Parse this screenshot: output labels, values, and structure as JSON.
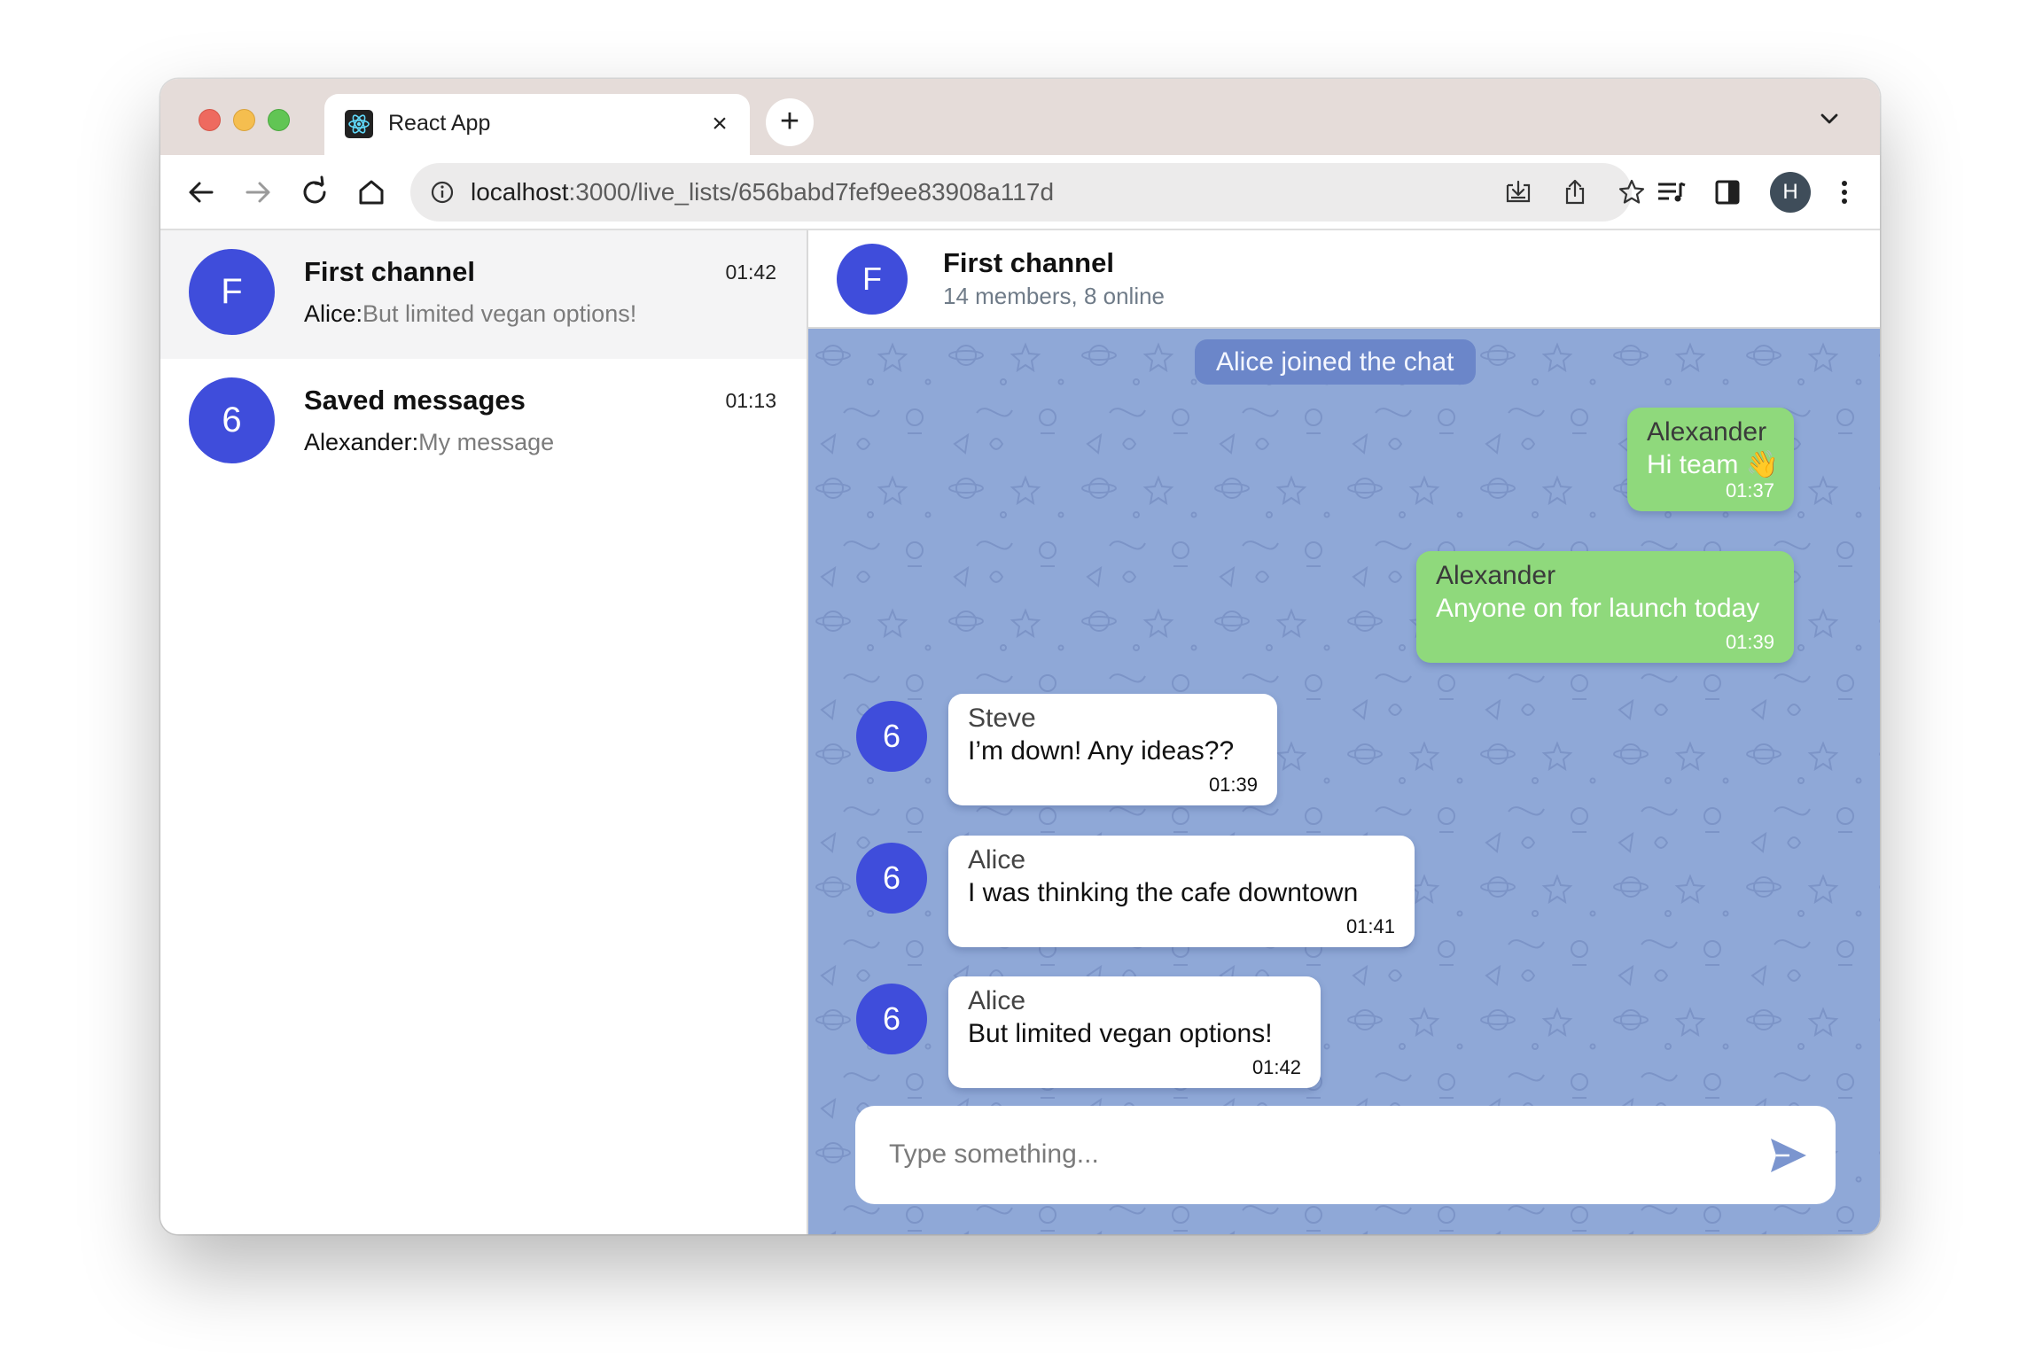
{
  "browser": {
    "tab_title": "React App",
    "tab_close": "×",
    "new_tab": "+",
    "url_host": "localhost",
    "url_path": ":3000/live_lists/656babd7fef9ee83908a117d",
    "profile_initial": "H"
  },
  "sidebar": {
    "chats": [
      {
        "avatar": "F",
        "name": "First channel",
        "time": "01:42",
        "sender": "Alice:",
        "preview": "But limited vegan options!"
      },
      {
        "avatar": "6",
        "name": "Saved messages",
        "time": "01:13",
        "sender": "Alexander:",
        "preview": "My message"
      }
    ]
  },
  "header": {
    "avatar": "F",
    "title": "First channel",
    "subtitle": "14 members, 8 online"
  },
  "messages": {
    "system": "Alice joined the chat",
    "items": [
      {
        "sender": "Alexander",
        "text": "Hi team 👋",
        "time": "01:37",
        "direction": "out"
      },
      {
        "sender": "Alexander",
        "text": "Anyone on for launch today",
        "time": "01:39",
        "direction": "out"
      },
      {
        "sender": "Steve",
        "avatar": "6",
        "text": "I’m down! Any ideas??",
        "time": "01:39",
        "direction": "in"
      },
      {
        "sender": "Alice",
        "avatar": "6",
        "text": "I was thinking the cafe downtown",
        "time": "01:41",
        "direction": "in"
      },
      {
        "sender": "Alice",
        "avatar": "6",
        "text": "But limited vegan options!",
        "time": "01:42",
        "direction": "in"
      }
    ]
  },
  "composer": {
    "placeholder": "Type something..."
  },
  "colors": {
    "avatar": "#3f4ddb",
    "chat_background": "#8fa8d7",
    "outgoing_bubble": "#8fd97c",
    "incoming_bubble": "#ffffff",
    "system_pill": "#6b86c9"
  },
  "icons": [
    "react-favicon",
    "back-arrow-icon",
    "forward-arrow-icon",
    "reload-icon",
    "home-icon",
    "info-icon",
    "install-icon",
    "share-icon",
    "star-icon",
    "reading-list-icon",
    "side-panel-icon",
    "more-vert-icon",
    "chevron-down-icon",
    "send-icon"
  ]
}
